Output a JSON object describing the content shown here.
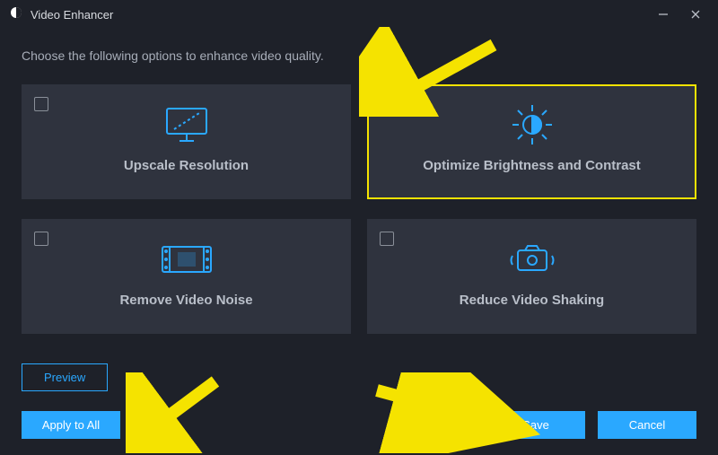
{
  "titlebar": {
    "title": "Video Enhancer"
  },
  "instruction": "Choose the following options to enhance video quality.",
  "cards": {
    "upscale": {
      "label": "Upscale Resolution",
      "checked": false
    },
    "brightness": {
      "label": "Optimize Brightness and Contrast",
      "checked": true
    },
    "noise": {
      "label": "Remove Video Noise",
      "checked": false
    },
    "shaking": {
      "label": "Reduce Video Shaking",
      "checked": false
    }
  },
  "buttons": {
    "preview": "Preview",
    "apply": "Apply to All",
    "save": "Save",
    "cancel": "Cancel"
  },
  "colors": {
    "accent": "#2aa8ff",
    "highlight": "#f5e300"
  }
}
